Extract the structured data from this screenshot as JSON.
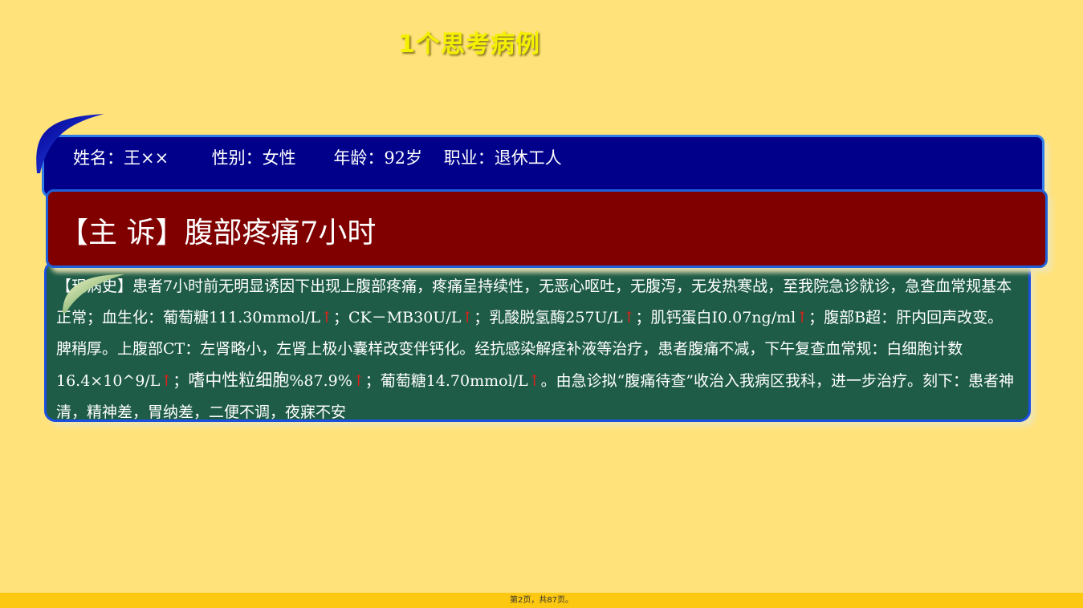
{
  "title": "1个思考病例",
  "patient_info": "姓名：王××        性别：女性       年龄：92岁    职业：退休工人",
  "complaint": "【主 诉】腹部疼痛7小时",
  "history": {
    "s1": "【现病史】患者7小时前无明显诱因下出现上腹部疼痛，疼痛呈持续性，无恶心呕吐，无腹泻，无发热寒战，至我院急诊就诊，急查血常规基本正常；血生化：葡萄糖111.30mmol/L",
    "s2": "；CK－MB30U/L",
    "s3": "；乳酸脱氢酶257U/L",
    "s4": "；肌钙蛋白I0.07ng/ml",
    "s5": "；腹部B超：肝内回声改变。脾稍厚。上腹部CT：左肾略小，左肾上极小囊样改变伴钙化。经抗感染解痉补液等治疗，患者腹痛不减，下午复查血常规：白细胞计数16.4×10^9/L",
    "s6": "；",
    "s6b": "嗜中性粒细胞",
    "s6c": "%87.9%",
    "s7": "；葡萄糖14.70mmol/L",
    "s8": "。由急诊拟“腹痛待查”收治入我病区我科，进一步治疗。刻下：患者神清，精神差，胃纳差，二便不调，夜寐不安",
    "arrow": "↑"
  },
  "footer": "第2页，共87页。",
  "colors": {
    "background": "#ffe27a",
    "title": "#f5f000",
    "info_box": "#00008b",
    "complaint_box": "#800000",
    "history_box": "#1e5c48",
    "arrow": "#e0201a"
  }
}
